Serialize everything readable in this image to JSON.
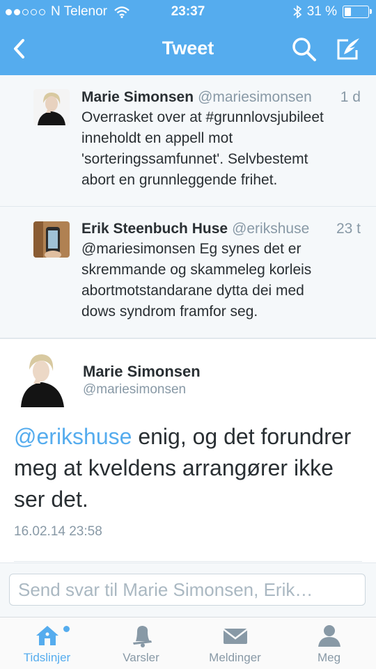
{
  "status": {
    "signal_dots": 5,
    "signal_on": 2,
    "carrier": "N Telenor",
    "time": "23:37",
    "battery": "31 %",
    "battery_level": 0.31
  },
  "nav": {
    "title": "Tweet"
  },
  "tweets": [
    {
      "name": "Marie Simonsen",
      "handle": "@mariesimonsen",
      "age": "1 d",
      "lines": [
        "Overrasket over at #grunnlovsjubileet",
        "inneholdt en appell mot",
        "'sorteringssamfunnet'. Selvbestemt",
        "abort en grunnleggende frihet."
      ]
    },
    {
      "name": "Erik Steenbuch Huse",
      "handle": "@erikshuse",
      "age": "23 t",
      "lines": [
        "@mariesimonsen Eg synes det er",
        "skremmande og skammeleg korleis",
        "abortmotstandarane dytta dei med",
        "dows syndrom framfor seg."
      ]
    }
  ],
  "main": {
    "name": "Marie Simonsen",
    "handle": "@mariesimonsen",
    "mention": "@erikshuse",
    "body_line1_rest": " enig, og det forundrer",
    "body_line2": "meg at kveldens arrangører ikke",
    "body_line3": "ser det.",
    "date": "16.02.14 23:58"
  },
  "reply": {
    "placeholder": "Send svar til Marie Simonsen, Erik…"
  },
  "tabs": [
    {
      "label": "Tidslinjer",
      "icon": "home-icon",
      "active": true
    },
    {
      "label": "Varsler",
      "icon": "bell-icon",
      "active": false
    },
    {
      "label": "Meldinger",
      "icon": "envelope-icon",
      "active": false
    },
    {
      "label": "Meg",
      "icon": "person-icon",
      "active": false
    }
  ],
  "colors": {
    "brand": "#55acee",
    "text": "#292f33",
    "muted": "#8899a6",
    "background": "#f5f8fa"
  }
}
